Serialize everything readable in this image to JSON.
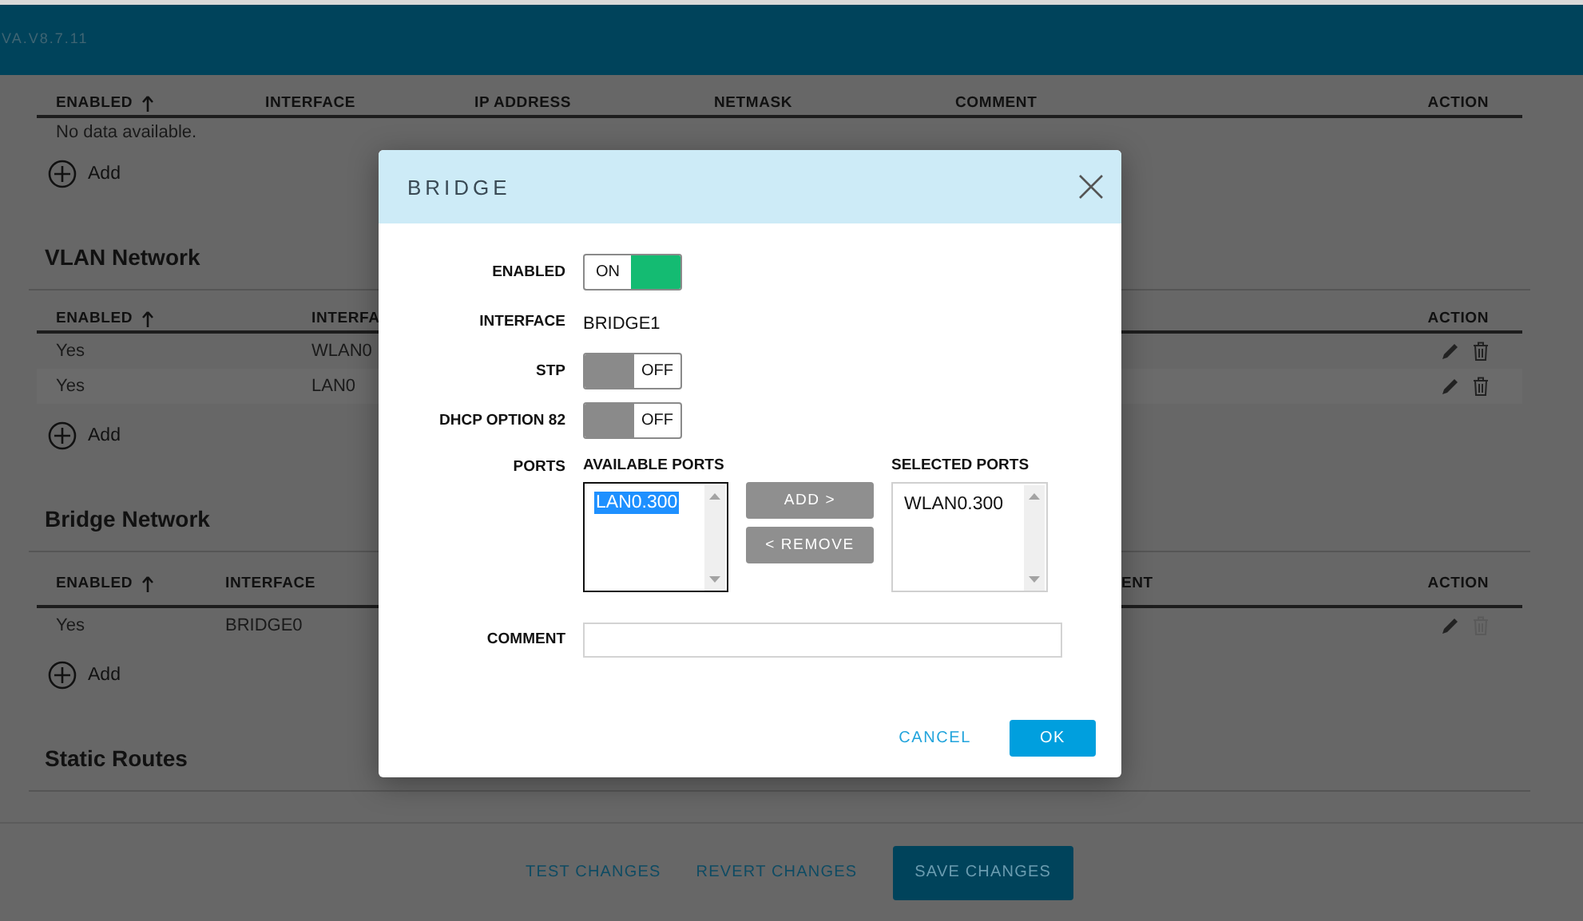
{
  "header": {
    "version": "VA.V8.7.11"
  },
  "tables": [
    {
      "columns": [
        {
          "label": "ENABLED",
          "sorted": true
        },
        {
          "label": "INTERFACE",
          "sorted": false
        },
        {
          "label": "IP ADDRESS",
          "sorted": false
        },
        {
          "label": "NETMASK",
          "sorted": false
        },
        {
          "label": "COMMENT",
          "sorted": false
        },
        {
          "label": "ACTION",
          "sorted": false
        }
      ],
      "empty_text": "No data available.",
      "add_label": "Add"
    },
    {
      "title": "VLAN Network",
      "columns": [
        {
          "label": "ENABLED",
          "sorted": true
        },
        {
          "label": "INTERFA",
          "sorted": false
        },
        {
          "label": "ACTION",
          "sorted": false
        }
      ],
      "rows": [
        {
          "cells": [
            "Yes",
            "WLAN0"
          ],
          "delete_enabled": true
        },
        {
          "cells": [
            "Yes",
            "LAN0"
          ],
          "delete_enabled": true
        }
      ],
      "add_label": "Add"
    },
    {
      "title": "Bridge Network",
      "columns": [
        {
          "label": "ENABLED",
          "sorted": true
        },
        {
          "label": "INTERFACE",
          "sorted": false
        },
        {
          "label": "ENT",
          "sorted": false
        },
        {
          "label": "ACTION",
          "sorted": false
        }
      ],
      "rows": [
        {
          "cells": [
            "Yes",
            "BRIDGE0"
          ],
          "delete_enabled": false
        }
      ],
      "add_label": "Add"
    },
    {
      "title": "Static Routes"
    }
  ],
  "footer": {
    "buttons": [
      {
        "label": "TEST CHANGES",
        "kind": "link"
      },
      {
        "label": "REVERT CHANGES",
        "kind": "link"
      },
      {
        "label": "SAVE CHANGES",
        "kind": "primary"
      }
    ]
  },
  "dialog": {
    "title": "BRIDGE",
    "fields": [
      {
        "kind": "toggle",
        "label": "ENABLED",
        "on": true,
        "text": "ON"
      },
      {
        "kind": "text",
        "label": "INTERFACE",
        "value": "BRIDGE1"
      },
      {
        "kind": "toggle",
        "label": "STP",
        "on": false,
        "text": "OFF"
      },
      {
        "kind": "toggle",
        "label": "DHCP OPTION 82",
        "on": false,
        "text": "OFF"
      },
      {
        "kind": "ports",
        "label": "PORTS",
        "available_label": "AVAILABLE PORTS",
        "available": [
          {
            "label": "LAN0.300",
            "selected": true
          }
        ],
        "add_button": "ADD >",
        "remove_button": "< REMOVE",
        "selected_label": "SELECTED PORTS",
        "chosen": [
          {
            "label": "WLAN0.300",
            "selected": false
          }
        ]
      },
      {
        "kind": "input",
        "label": "COMMENT"
      }
    ],
    "buttons": [
      {
        "label": "CANCEL",
        "kind": "link"
      },
      {
        "label": "OK",
        "kind": "primary"
      }
    ]
  }
}
